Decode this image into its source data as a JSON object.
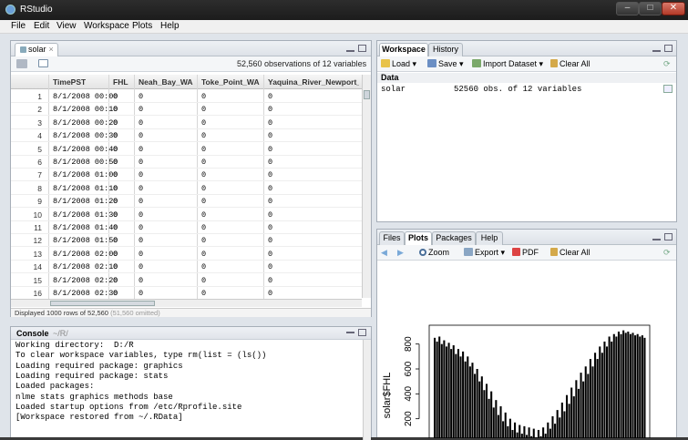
{
  "window": {
    "title": "RStudio"
  },
  "menu": [
    "File",
    "Edit",
    "View",
    "Workspace",
    "Plots",
    "Help"
  ],
  "source_pane": {
    "tab_label": "solar",
    "obs_text": "52,560 observations of 12 variables",
    "columns": [
      "TimePST",
      "FHL",
      "Neah_Bay_WA",
      "Toke_Point_WA",
      "Yaquina_River_Newport_O"
    ],
    "rows": [
      {
        "n": "1",
        "t": "8/1/2008 00:00",
        "a": "0",
        "b": "0",
        "c": "0",
        "d": "0"
      },
      {
        "n": "2",
        "t": "8/1/2008 00:10",
        "a": "0",
        "b": "0",
        "c": "0",
        "d": "0"
      },
      {
        "n": "3",
        "t": "8/1/2008 00:20",
        "a": "0",
        "b": "0",
        "c": "0",
        "d": "0"
      },
      {
        "n": "4",
        "t": "8/1/2008 00:30",
        "a": "0",
        "b": "0",
        "c": "0",
        "d": "0"
      },
      {
        "n": "5",
        "t": "8/1/2008 00:40",
        "a": "0",
        "b": "0",
        "c": "0",
        "d": "0"
      },
      {
        "n": "6",
        "t": "8/1/2008 00:50",
        "a": "0",
        "b": "0",
        "c": "0",
        "d": "0"
      },
      {
        "n": "7",
        "t": "8/1/2008 01:00",
        "a": "0",
        "b": "0",
        "c": "0",
        "d": "0"
      },
      {
        "n": "8",
        "t": "8/1/2008 01:10",
        "a": "0",
        "b": "0",
        "c": "0",
        "d": "0"
      },
      {
        "n": "9",
        "t": "8/1/2008 01:20",
        "a": "0",
        "b": "0",
        "c": "0",
        "d": "0"
      },
      {
        "n": "10",
        "t": "8/1/2008 01:30",
        "a": "0",
        "b": "0",
        "c": "0",
        "d": "0"
      },
      {
        "n": "11",
        "t": "8/1/2008 01:40",
        "a": "0",
        "b": "0",
        "c": "0",
        "d": "0"
      },
      {
        "n": "12",
        "t": "8/1/2008 01:50",
        "a": "0",
        "b": "0",
        "c": "0",
        "d": "0"
      },
      {
        "n": "13",
        "t": "8/1/2008 02:00",
        "a": "0",
        "b": "0",
        "c": "0",
        "d": "0"
      },
      {
        "n": "14",
        "t": "8/1/2008 02:10",
        "a": "0",
        "b": "0",
        "c": "0",
        "d": "0"
      },
      {
        "n": "15",
        "t": "8/1/2008 02:20",
        "a": "0",
        "b": "0",
        "c": "0",
        "d": "0"
      },
      {
        "n": "16",
        "t": "8/1/2008 02:30",
        "a": "0",
        "b": "0",
        "c": "0",
        "d": "0"
      }
    ],
    "footer": "Displayed 1000 rows of 52,560",
    "footer_omitted": "(51,560 omitted)"
  },
  "console": {
    "title": "Console",
    "path": "~/R/",
    "lines": [
      "Working directory:  D:/R",
      "To clear workspace variables, type rm(list = (ls())",
      "Loading required package: graphics",
      "Loading required package: stats",
      "Loaded packages:",
      "nlme stats graphics methods base",
      "Loaded startup options from /etc/Rprofile.site",
      "[Workspace restored from ~/.RData]"
    ]
  },
  "workspace_pane": {
    "tabs": [
      "Workspace",
      "History"
    ],
    "toolbar": {
      "load": "Load",
      "save": "Save",
      "import": "Import Dataset",
      "clear": "Clear All"
    },
    "section": "Data",
    "items": [
      {
        "name": "solar",
        "desc": "52560 obs. of 12 variables"
      }
    ]
  },
  "plots_pane": {
    "tabs": [
      "Files",
      "Plots",
      "Packages",
      "Help"
    ],
    "toolbar": {
      "zoom": "Zoom",
      "export": "Export",
      "pdf": "PDF",
      "clear": "Clear All"
    }
  },
  "chart_data": {
    "type": "bar",
    "ylabel": "solar$FHL",
    "yticks": [
      200,
      400,
      600,
      800
    ],
    "ylim": [
      0,
      900
    ],
    "series": [
      {
        "values": [
          850,
          820,
          860,
          800,
          830,
          780,
          810,
          760,
          790,
          720,
          760,
          700,
          740,
          660,
          700,
          620,
          650,
          560,
          600,
          500,
          540,
          430,
          480,
          360,
          420,
          290,
          350,
          230,
          300,
          180,
          250,
          140,
          200,
          110,
          170,
          90,
          150,
          80,
          140,
          70,
          130,
          60,
          120,
          50,
          110,
          60,
          130,
          80,
          170,
          120,
          220,
          160,
          270,
          210,
          330,
          260,
          390,
          320,
          450,
          380,
          510,
          440,
          570,
          500,
          620,
          560,
          680,
          620,
          730,
          680,
          780,
          730,
          820,
          780,
          860,
          820,
          880,
          860,
          900,
          880,
          910,
          890,
          900,
          880,
          890,
          870,
          880,
          860,
          870,
          850
        ]
      }
    ]
  }
}
